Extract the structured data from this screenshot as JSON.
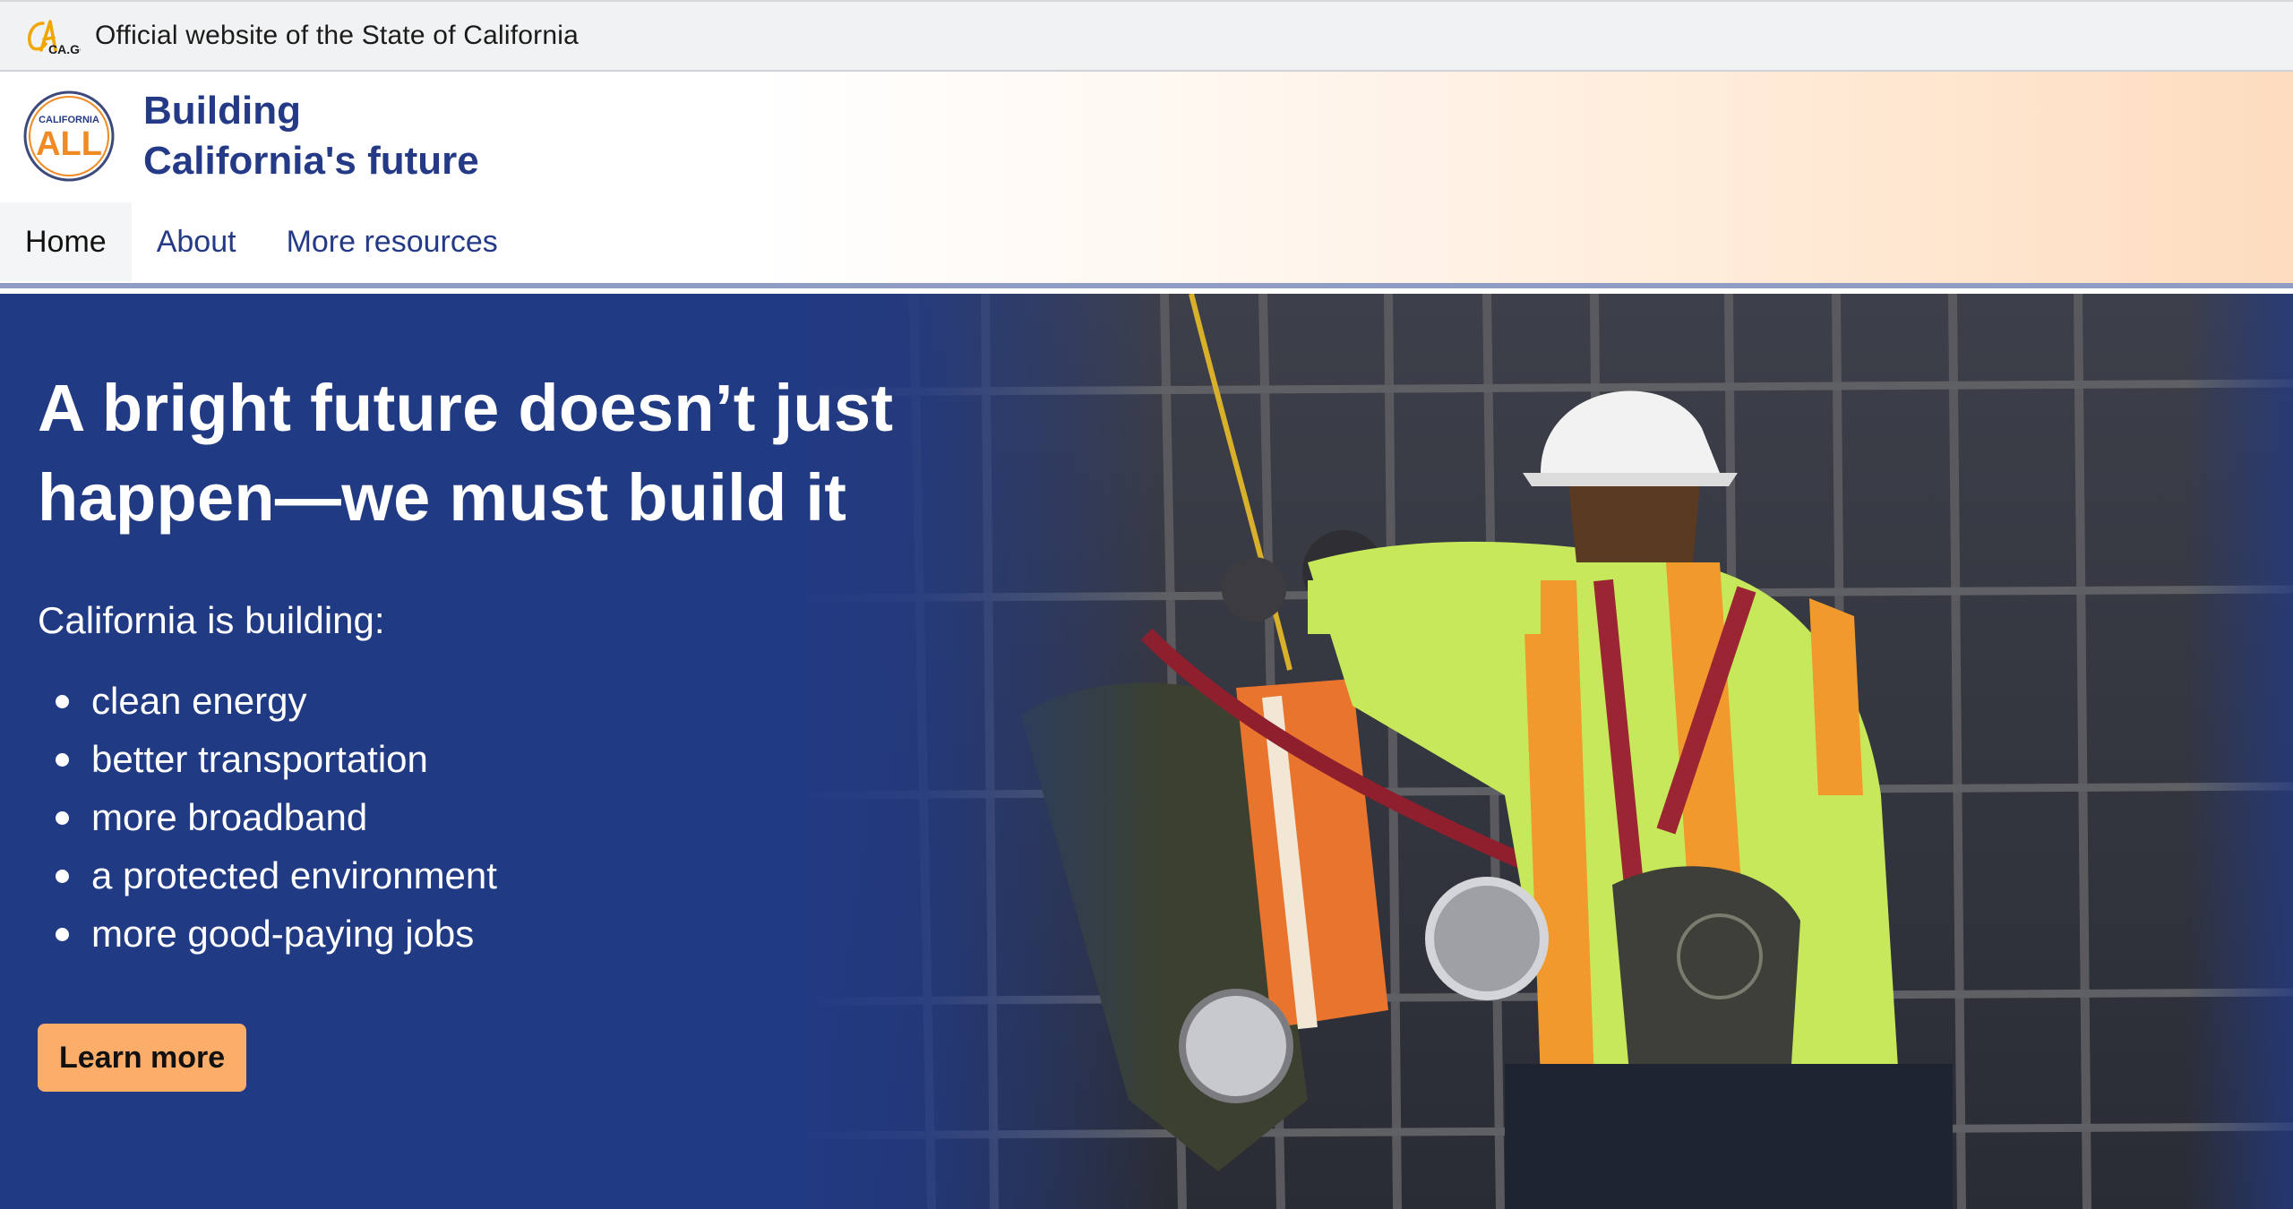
{
  "official_banner": {
    "logo_text": "CA.GOV",
    "text": "Official website of the State of California"
  },
  "header": {
    "logo_top": "CALIFORNIA",
    "logo_main": "ALL",
    "title_line1": "Building",
    "title_line2": "California's future",
    "nav": [
      {
        "label": "Home",
        "active": true
      },
      {
        "label": "About",
        "active": false
      },
      {
        "label": "More resources",
        "active": false
      }
    ]
  },
  "hero": {
    "heading_line1": "A bright future doesn’t just",
    "heading_line2": "happen—we must build it",
    "intro": "California is building:",
    "items": [
      "clean energy",
      "better transportation",
      "more broadband",
      "a protected environment",
      "more good-paying jobs"
    ],
    "cta_label": "Learn more"
  },
  "colors": {
    "navy": "#213a84",
    "brand_blue": "#253a86",
    "cta_orange": "#fbad69",
    "logo_orange": "#f08a24"
  }
}
